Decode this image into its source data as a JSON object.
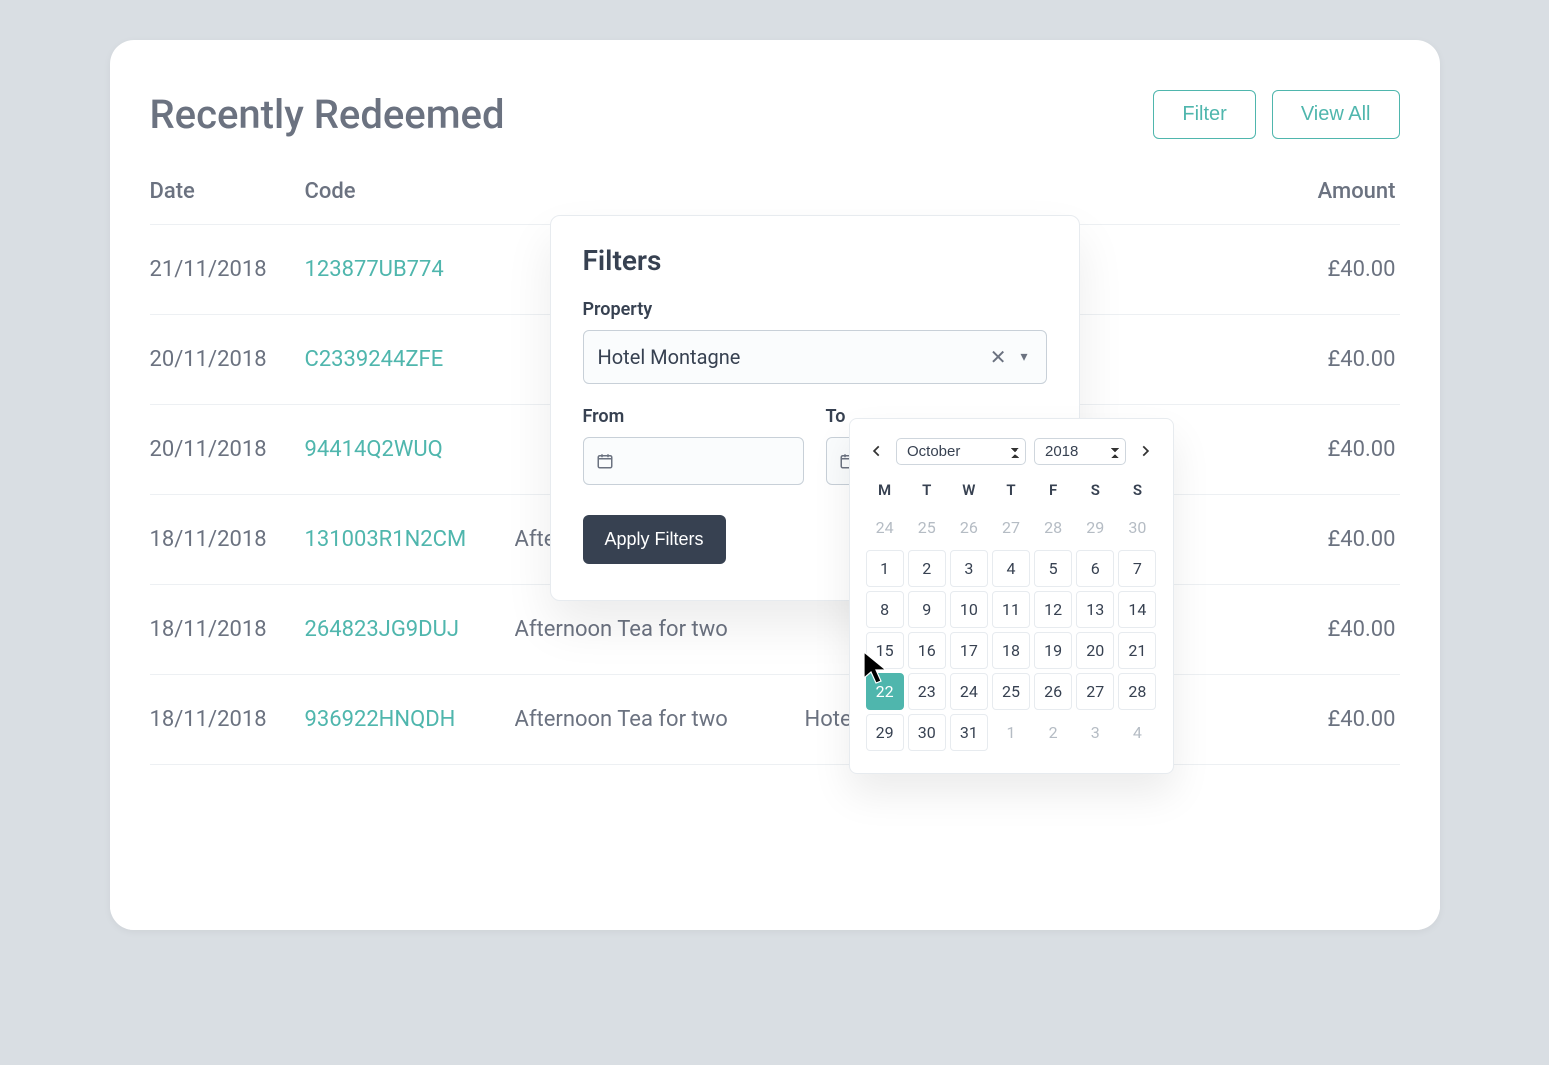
{
  "header": {
    "title": "Recently Redeemed",
    "filter_label": "Filter",
    "view_all_label": "View All"
  },
  "columns": {
    "date": "Date",
    "code": "Code",
    "desc": "",
    "venue": "",
    "amount": "Amount"
  },
  "rows": [
    {
      "date": "21/11/2018",
      "code": "123877UB774",
      "desc": "",
      "venue": "",
      "amount": "£40.00"
    },
    {
      "date": "20/11/2018",
      "code": "C2339244ZFE",
      "desc": "",
      "venue": "",
      "amount": "£40.00"
    },
    {
      "date": "20/11/2018",
      "code": "94414Q2WUQ",
      "desc": "",
      "venue": "",
      "amount": "£40.00"
    },
    {
      "date": "18/11/2018",
      "code": "131003R1N2CM",
      "desc": "Afternoon Tea for two",
      "venue": "",
      "amount": "£40.00"
    },
    {
      "date": "18/11/2018",
      "code": "264823JG9DUJ",
      "desc": "Afternoon Tea for two",
      "venue": "",
      "amount": "£40.00"
    },
    {
      "date": "18/11/2018",
      "code": "936922HNQDH",
      "desc": "Afternoon Tea for two",
      "venue": "Hotel Montagne",
      "amount": "£40.00"
    }
  ],
  "filters": {
    "title": "Filters",
    "property_label": "Property",
    "property_value": "Hotel Montagne",
    "from_label": "From",
    "to_label": "To",
    "apply_label": "Apply Filters"
  },
  "calendar": {
    "month": "October",
    "year": "2018",
    "dow": [
      "M",
      "T",
      "W",
      "T",
      "F",
      "S",
      "S"
    ],
    "prev_tail": [
      24,
      25,
      26,
      27,
      28,
      29,
      30
    ],
    "days": [
      1,
      2,
      3,
      4,
      5,
      6,
      7,
      8,
      9,
      10,
      11,
      12,
      13,
      14,
      15,
      16,
      17,
      18,
      19,
      20,
      21,
      22,
      23,
      24,
      25,
      26,
      27,
      28,
      29,
      30,
      31
    ],
    "selected": 22,
    "next_head": [
      1,
      2,
      3,
      4
    ]
  }
}
